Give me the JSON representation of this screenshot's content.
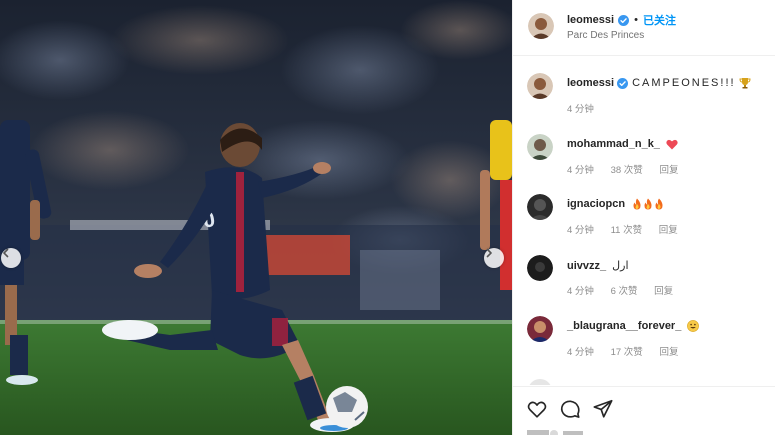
{
  "post": {
    "username": "leomessi",
    "follow_status": "已关注",
    "separator": "•",
    "location": "Parc Des Princes"
  },
  "caption": {
    "username": "leomessi",
    "text": "CAMPEONES!!!",
    "emoji": "trophy",
    "time": "4 分钟"
  },
  "comments": [
    {
      "username": "mohammad_n_k_",
      "text": "",
      "emoji": "red-heart",
      "time": "4 分钟",
      "likes": "38 次赞",
      "reply": "回复"
    },
    {
      "username": "ignaciopcn",
      "text": "",
      "emoji": "fire x3",
      "time": "4 分钟",
      "likes": "11 次赞",
      "reply": "回复"
    },
    {
      "username": "uivvzz_",
      "text": "ارل",
      "emoji": "",
      "time": "4 分钟",
      "likes": "6 次赞",
      "reply": "回复"
    },
    {
      "username": "_blaugrana__forever_",
      "text": "",
      "emoji": "grinning-face",
      "time": "4 分钟",
      "likes": "17 次赞",
      "reply": "回复"
    }
  ],
  "actions": {
    "icons": [
      "heart-icon",
      "comment-icon",
      "share-icon"
    ]
  },
  "colors": {
    "accent_blue": "#0095f6",
    "verified_blue": "#3897f0",
    "heart_red": "#ed4956",
    "pitch_green": "#2f6a2a",
    "psg_navy": "#1b2a4a"
  }
}
